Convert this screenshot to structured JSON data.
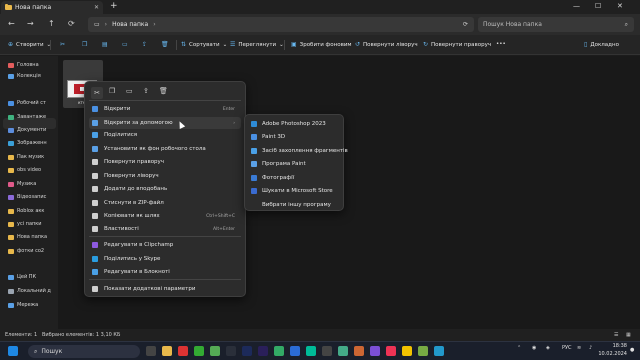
{
  "tab": {
    "title": "Нова папка",
    "close": "✕",
    "new": "+"
  },
  "window": {
    "minimize": "—",
    "maximize": "☐",
    "close": "✕"
  },
  "address": {
    "path": "Нова папка",
    "search_placeholder": "Пошук Нова папка"
  },
  "commands": {
    "create": "Створити",
    "sort": "Сортувати",
    "view": "Переглянути",
    "set_bg": "Зробити фоновим",
    "rotate_left": "Повернути ліворуч",
    "rotate_right": "Повернути праворуч",
    "more": "•••",
    "details": "Докладно"
  },
  "sidebar": {
    "items": [
      {
        "label": "Головна",
        "color": "#e35d5d"
      },
      {
        "label": "Колекція",
        "color": "#5aa0e6"
      },
      {
        "label": "Робочий ст",
        "color": "#4a90e2"
      },
      {
        "label": "Завантаже",
        "color": "#3fb27f"
      },
      {
        "label": "Документи",
        "color": "#5c8ddc"
      },
      {
        "label": "Зображенн",
        "color": "#3ba0d8"
      },
      {
        "label": "Пак музик",
        "color": "#e8b84b"
      },
      {
        "label": "obs video",
        "color": "#e8b84b"
      },
      {
        "label": "Музика",
        "color": "#e05a8a"
      },
      {
        "label": "Відеозапис",
        "color": "#8b6ad8"
      },
      {
        "label": "Roblox акк",
        "color": "#e8b84b"
      },
      {
        "label": "усі папки",
        "color": "#e8b84b"
      },
      {
        "label": "Нова папка",
        "color": "#e8b84b"
      },
      {
        "label": "фотки со2",
        "color": "#e8b84b"
      },
      {
        "label": "Цей ПК",
        "color": "#5aa0e6"
      },
      {
        "label": "Локальний д",
        "color": "#9aa4b0"
      },
      {
        "label": "Мережа",
        "color": "#5aa0e6"
      }
    ]
  },
  "file": {
    "name": "ктел"
  },
  "context_menu": {
    "items": [
      {
        "label": "Відкрити",
        "shortcut": "Enter",
        "color": "#4a90e2"
      },
      {
        "label": "Відкрити за допомогою",
        "shortcut": "›",
        "color": "#5aa0e6"
      },
      {
        "label": "Поділитися",
        "shortcut": "",
        "color": "#4aa0e6"
      },
      {
        "label": "Установити як фон робочого стола",
        "shortcut": "",
        "color": "#5aa0e6"
      },
      {
        "label": "Повернути праворуч",
        "shortcut": "",
        "color": "#cfcfcf"
      },
      {
        "label": "Повернути ліворуч",
        "shortcut": "",
        "color": "#cfcfcf"
      },
      {
        "label": "Додати до вподобань",
        "shortcut": "",
        "color": "#cfcfcf"
      },
      {
        "label": "Стиснути в ZIP-файл",
        "shortcut": "",
        "color": "#cfcfcf"
      },
      {
        "label": "Копіювати як шлях",
        "shortcut": "Ctrl+Shift+C",
        "color": "#cfcfcf"
      },
      {
        "label": "Властивості",
        "shortcut": "Alt+Enter",
        "color": "#cfcfcf"
      },
      {
        "label": "Редагувати в Clipchamp",
        "shortcut": "",
        "color": "#8e5ae0"
      },
      {
        "label": "Поділитись у Skype",
        "shortcut": "",
        "color": "#2a9de0"
      },
      {
        "label": "Редагувати в Блокноті",
        "shortcut": "",
        "color": "#4aa0e6"
      },
      {
        "label": "Показати додаткові параметри",
        "shortcut": "",
        "color": "#cfcfcf"
      }
    ]
  },
  "submenu": {
    "items": [
      {
        "label": "Adobe Photoshop 2023",
        "color": "#2e8bd6"
      },
      {
        "label": "Paint 3D",
        "color": "#4a90e2"
      },
      {
        "label": "Засіб захоплення фрагментів",
        "color": "#4aa0e6"
      },
      {
        "label": "Програма Paint",
        "color": "#5aa0e6"
      },
      {
        "label": "Фотографії",
        "color": "#3a7bd5"
      },
      {
        "label": "Шукати в Microsoft Store",
        "color": "#3a6bd0"
      },
      {
        "label": "Вибрати іншу програму",
        "color": ""
      }
    ]
  },
  "status": {
    "elements": "Елементи: 1",
    "selected": "Вибрано елементів: 1   3,10 КБ"
  },
  "taskbar": {
    "search": "Пошук",
    "lang": "РУС",
    "time": "18:38",
    "date": "10.02.2024"
  }
}
